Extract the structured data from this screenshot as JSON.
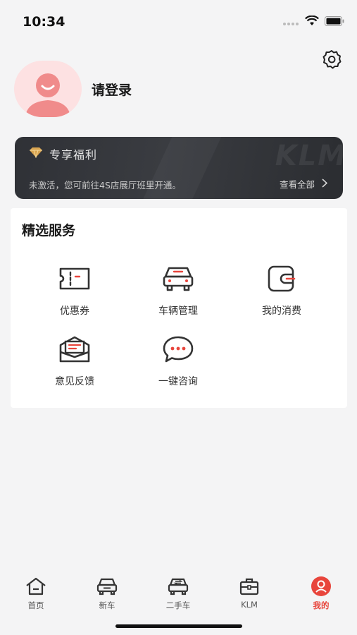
{
  "status_bar": {
    "time": "10:34"
  },
  "profile": {
    "login_label": "请登录"
  },
  "benefits": {
    "title": "专享福利",
    "watermark": "KLM",
    "description": "未激活，您可前往4S店展厅班里开通。",
    "view_all_label": "查看全部"
  },
  "services": {
    "title": "精选服务",
    "items": [
      {
        "label": "优惠券",
        "icon": "coupon-icon"
      },
      {
        "label": "车辆管理",
        "icon": "car-icon"
      },
      {
        "label": "我的消费",
        "icon": "wallet-icon"
      },
      {
        "label": "意见反馈",
        "icon": "feedback-mail-icon"
      },
      {
        "label": "一键咨询",
        "icon": "chat-icon"
      }
    ]
  },
  "tabbar": {
    "items": [
      {
        "label": "首页",
        "icon": "home-icon",
        "active": false
      },
      {
        "label": "新车",
        "icon": "new-car-icon",
        "active": false
      },
      {
        "label": "二手车",
        "icon": "used-car-icon",
        "active": false
      },
      {
        "label": "KLM",
        "icon": "briefcase-icon",
        "active": false
      },
      {
        "label": "我的",
        "icon": "profile-icon",
        "active": true
      }
    ]
  },
  "colors": {
    "accent": "#e8453c",
    "card_dark": "#2f3136",
    "gold": "#d9a551"
  }
}
